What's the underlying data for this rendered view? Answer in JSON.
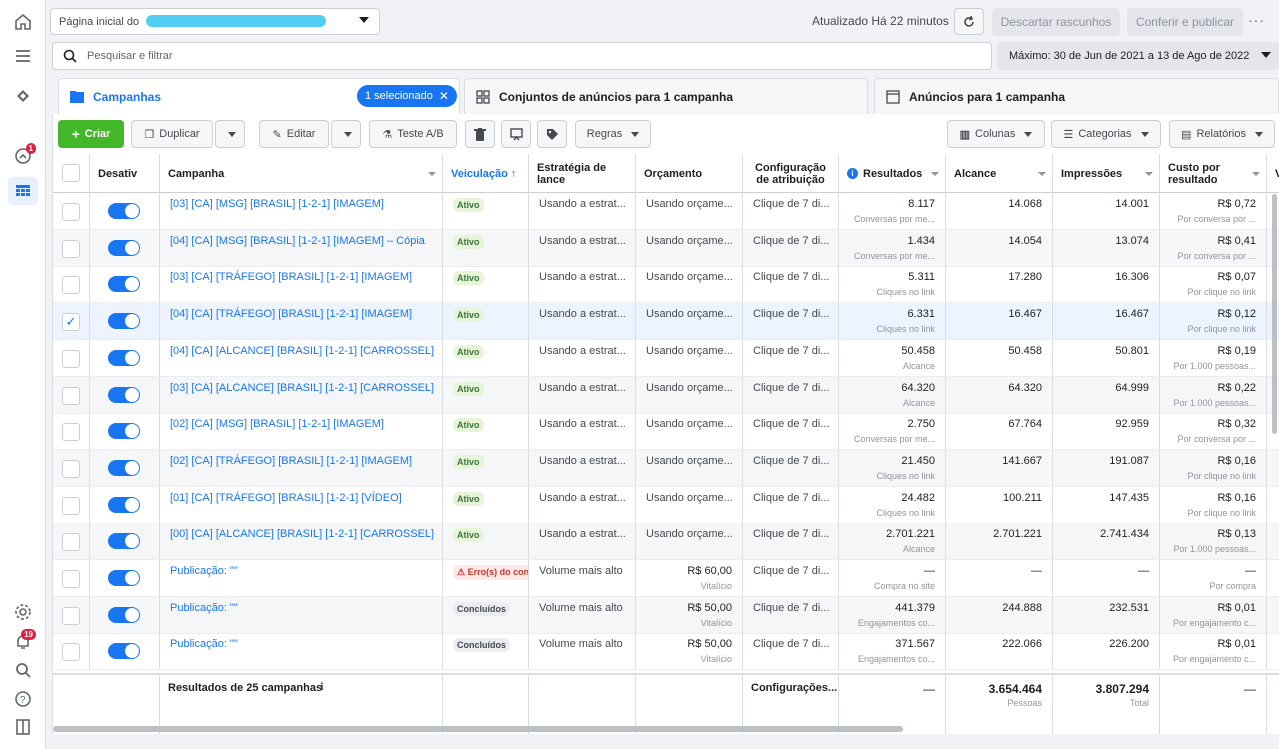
{
  "topbar": {
    "account_label": "Página inicial do",
    "updated": "Atualizado Há 22 minutos",
    "discard": "Descartar rascunhos",
    "publish": "Conferir e publicar",
    "more": "···"
  },
  "search": {
    "placeholder": "Pesquisar e filtrar"
  },
  "daterange": "Máximo: 30 de Jun de 2021 a 13 de Ago de 2022",
  "tabs": {
    "campaigns": "Campanhas",
    "selected": "1 selecionado",
    "adsets": "Conjuntos de anúncios para 1 campanha",
    "ads": "Anúncios para 1 campanha"
  },
  "toolbar": {
    "create": "Criar",
    "duplicate": "Duplicar",
    "edit": "Editar",
    "abtest": "Teste A/B",
    "rules": "Regras",
    "columns": "Colunas",
    "categories": "Categorias",
    "reports": "Relatórios"
  },
  "rail": {
    "notif_badge": "1",
    "alerts_badge": "19"
  },
  "columns": {
    "off": "Desativ",
    "campaign": "Campanha",
    "delivery": "Veiculação ↑",
    "bid": "Estratégia de lance",
    "budget": "Orçamento",
    "attribution": "Configuração de atribuição",
    "results": "Resultados",
    "reach": "Alcance",
    "impressions": "Impressões",
    "cpr": "Custo por resultado",
    "extra": "V"
  },
  "rows": [
    {
      "name": "[03] [CA] [MSG] [BRASIL] [1-2-1] [IMAGEM]",
      "status": "Ativo",
      "st": "ativo",
      "bid": "Usando a estrat...",
      "budget": "Usando orçame...",
      "budget_sub": "",
      "attr": "Clique de 7 di...",
      "results": "8.117",
      "results_sub": "Conversas por me...",
      "reach": "14.068",
      "impr": "14.001",
      "cpr": "R$ 0,72",
      "cpr_sub": "Por conversa por ..."
    },
    {
      "name": "[04] [CA] [MSG] [BRASIL] [1-2-1] [IMAGEM] – Cópia",
      "status": "Ativo",
      "st": "ativo",
      "bid": "Usando a estrat...",
      "budget": "Usando orçame...",
      "budget_sub": "",
      "attr": "Clique de 7 di...",
      "results": "1.434",
      "results_sub": "Conversas por me...",
      "reach": "14.054",
      "impr": "13.074",
      "cpr": "R$ 0,41",
      "cpr_sub": "Por conversa por ..."
    },
    {
      "name": "[03] [CA] [TRÁFEGO] [BRASIL] [1-2-1] [IMAGEM]",
      "status": "Ativo",
      "st": "ativo",
      "bid": "Usando a estrat...",
      "budget": "Usando orçame...",
      "budget_sub": "",
      "attr": "Clique de 7 di...",
      "results": "5.311",
      "results_sub": "Cliques no link",
      "reach": "17.280",
      "impr": "16.306",
      "cpr": "R$ 0,07",
      "cpr_sub": "Por clique no link"
    },
    {
      "name": "[04] [CA] [TRÁFEGO] [BRASIL] [1-2-1] [IMAGEM]",
      "status": "Ativo",
      "st": "ativo",
      "bid": "Usando a estrat...",
      "budget": "Usando orçame...",
      "budget_sub": "",
      "attr": "Clique de 7 di...",
      "results": "6.331",
      "results_sub": "Cliques no link",
      "reach": "16.467",
      "impr": "16.467",
      "cpr": "R$ 0,12",
      "cpr_sub": "Por clique no link",
      "checked": "✓"
    },
    {
      "name": "[04] [CA] [ALCANCE] [BRASIL] [1-2-1] [CARROSSEL]",
      "status": "Ativo",
      "st": "ativo",
      "bid": "Usando a estrat...",
      "budget": "Usando orçame...",
      "budget_sub": "",
      "attr": "Clique de 7 di...",
      "results": "50.458",
      "results_sub": "Alcance",
      "reach": "50.458",
      "impr": "50.801",
      "cpr": "R$ 0,19",
      "cpr_sub": "Por 1.000 pessoas..."
    },
    {
      "name": "[03] [CA] [ALCANCE] [BRASIL] [1-2-1] [CARROSSEL]",
      "status": "Ativo",
      "st": "ativo",
      "bid": "Usando a estrat...",
      "budget": "Usando orçame...",
      "budget_sub": "",
      "attr": "Clique de 7 di...",
      "results": "64.320",
      "results_sub": "Alcance",
      "reach": "64.320",
      "impr": "64.999",
      "cpr": "R$ 0,22",
      "cpr_sub": "Por 1.000 pessoas..."
    },
    {
      "name": "[02] [CA] [MSG] [BRASIL] [1-2-1] [IMAGEM]",
      "status": "Ativo",
      "st": "ativo",
      "bid": "Usando a estrat...",
      "budget": "Usando orçame...",
      "budget_sub": "",
      "attr": "Clique de 7 di...",
      "results": "2.750",
      "results_sub": "Conversas por me...",
      "reach": "67.764",
      "impr": "92.959",
      "cpr": "R$ 0,32",
      "cpr_sub": "Por conversa por ..."
    },
    {
      "name": "[02] [CA] [TRÁFEGO] [BRASIL] [1-2-1] [IMAGEM]",
      "status": "Ativo",
      "st": "ativo",
      "bid": "Usando a estrat...",
      "budget": "Usando orçame...",
      "budget_sub": "",
      "attr": "Clique de 7 di...",
      "results": "21.450",
      "results_sub": "Cliques no link",
      "reach": "141.667",
      "impr": "191.087",
      "cpr": "R$ 0,16",
      "cpr_sub": "Por clique no link"
    },
    {
      "name": "[01] [CA] [TRÁFEGO] [BRASIL] [1-2-1] [VÍDEO]",
      "status": "Ativo",
      "st": "ativo",
      "bid": "Usando a estrat...",
      "budget": "Usando orçame...",
      "budget_sub": "",
      "attr": "Clique de 7 di...",
      "results": "24.482",
      "results_sub": "Cliques no link",
      "reach": "100.211",
      "impr": "147.435",
      "cpr": "R$ 0,16",
      "cpr_sub": "Por clique no link"
    },
    {
      "name": "[00] [CA] [ALCANCE] [BRASIL] [1-2-1] [CARROSSEL]",
      "status": "Ativo",
      "st": "ativo",
      "bid": "Usando a estrat...",
      "budget": "Usando orçame...",
      "budget_sub": "",
      "attr": "Clique de 7 di...",
      "results": "2.701.221",
      "results_sub": "Alcance",
      "reach": "2.701.221",
      "impr": "2.741.434",
      "cpr": "R$ 0,13",
      "cpr_sub": "Por 1.000 pessoas..."
    },
    {
      "name": "Publicação: \"\"",
      "status": "⚠ Erro(s) do con",
      "st": "err",
      "bid": "Volume mais alto",
      "budget": "R$ 60,00",
      "budget_sub": "Vitalício",
      "attr": "Clique de 7 di...",
      "results": "—",
      "results_sub": "Compra no site",
      "reach": "—",
      "impr": "—",
      "cpr": "—",
      "cpr_sub": "Por compra"
    },
    {
      "name": "Publicação: \"\"",
      "status": "Concluídos",
      "st": "conc",
      "bid": "Volume mais alto",
      "budget": "R$ 50,00",
      "budget_sub": "Vitalício",
      "attr": "Clique de 7 di...",
      "results": "441.379",
      "results_sub": "Engajamentos co...",
      "reach": "244.888",
      "impr": "232.531",
      "cpr": "R$ 0,01",
      "cpr_sub": "Por engajamento c..."
    },
    {
      "name": "Publicação: \"\"",
      "status": "Concluídos",
      "st": "conc",
      "bid": "Volume mais alto",
      "budget": "R$ 50,00",
      "budget_sub": "Vitalício",
      "attr": "Clique de 7 di...",
      "results": "371.567",
      "results_sub": "Engajamentos co...",
      "reach": "222.066",
      "impr": "226.200",
      "cpr": "R$ 0,01",
      "cpr_sub": "Por engajamento c..."
    }
  ],
  "footer": {
    "label": "Resultados de 25 campanhas",
    "info_icon": "ℹ",
    "attr": "Configurações...",
    "results": "—",
    "reach": "3.654.464",
    "reach_sub": "Pessoas",
    "impr": "3.807.294",
    "impr_sub": "Total",
    "cpr": "—"
  }
}
